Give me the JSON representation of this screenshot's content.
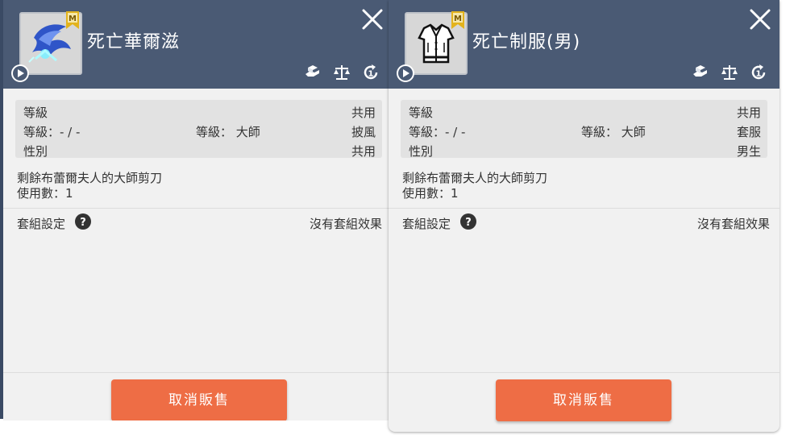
{
  "panels": [
    {
      "title": "死亡華爾滋",
      "badge": "M",
      "stats": [
        {
          "left": "等級",
          "middle": "",
          "right": "共用"
        },
        {
          "left": "等級：- / -",
          "middle": "等級： 大師",
          "right": "披風"
        },
        {
          "left": "性別",
          "middle": "",
          "right": "共用"
        }
      ],
      "desc_line1": "剩餘布蕾爾夫人的大師剪刀",
      "desc_line2": "使用數：1",
      "set_label": "套組設定",
      "set_value": "沒有套組效果",
      "action_label": "取消販售"
    },
    {
      "title": "死亡制服(男)",
      "badge": "M",
      "stats": [
        {
          "left": "等級",
          "middle": "",
          "right": "共用"
        },
        {
          "left": "等級：- / -",
          "middle": "等級： 大師",
          "right": "套服"
        },
        {
          "left": "性別",
          "middle": "",
          "right": "男生"
        }
      ],
      "desc_line1": "剩餘布蕾爾夫人的大師剪刀",
      "desc_line2": "使用數：1",
      "set_label": "套組設定",
      "set_value": "沒有套組效果",
      "action_label": "取消販售"
    }
  ],
  "colors": {
    "header": "#4a5a74",
    "panel_bg": "#f1f1f1",
    "stats_bg": "#e2e2e2",
    "action": "#ee6d45",
    "badge": "#e3b31c"
  },
  "icons": [
    "close-icon",
    "play-icon",
    "hand-coin-icon",
    "scale-icon",
    "refresh-one-icon",
    "question-icon",
    "master-badge-icon"
  ]
}
